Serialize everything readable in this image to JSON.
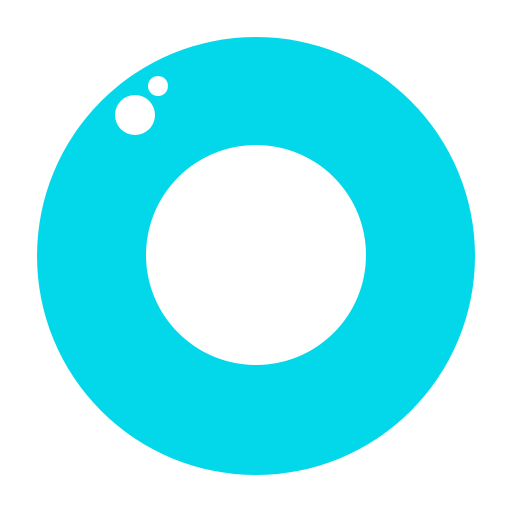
{
  "logo": {
    "icon": "ring-logo-icon",
    "ring_color": "#03d8ea",
    "background_color": "#ffffff",
    "hole_color": "#ffffff",
    "highlight_color": "#ffffff"
  }
}
